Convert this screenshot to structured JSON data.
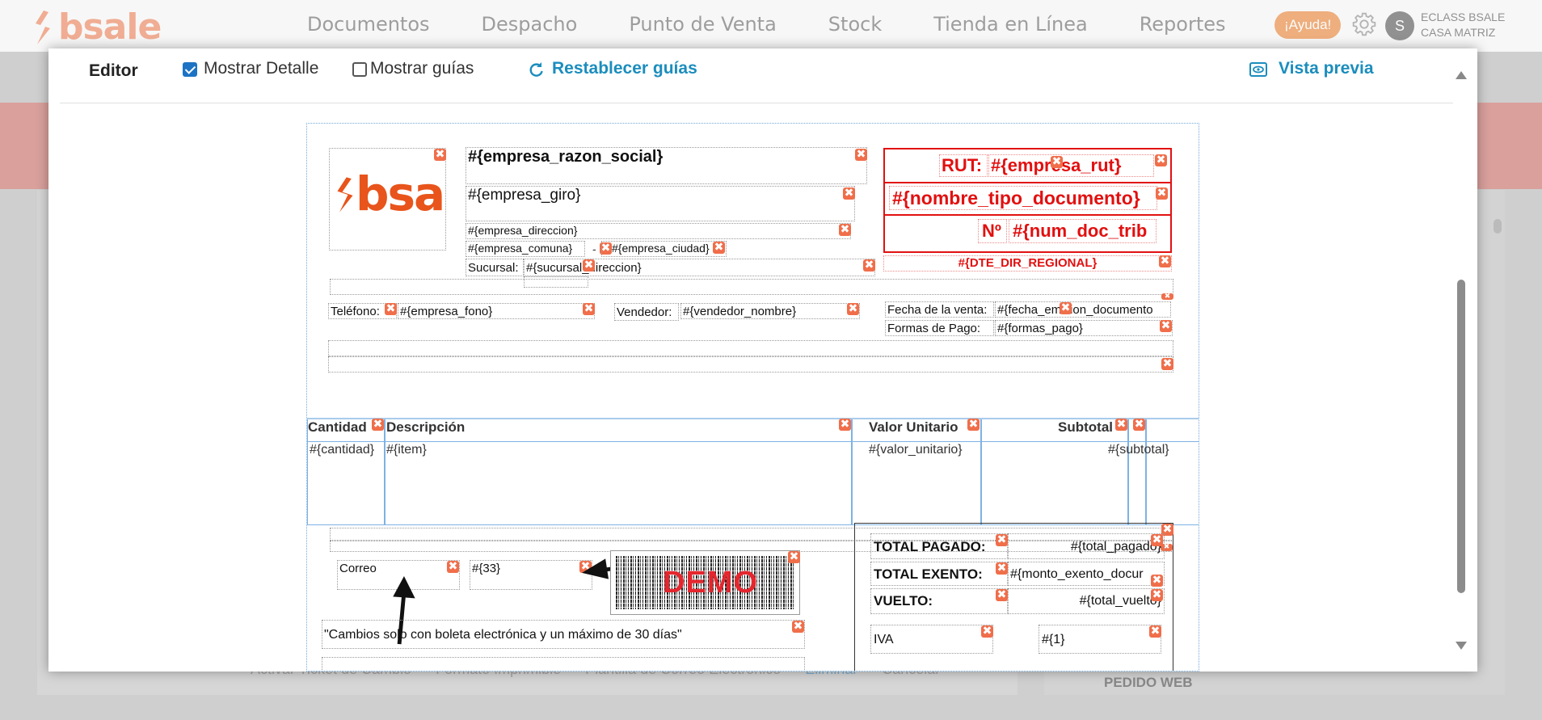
{
  "app": {
    "brand": "bsale",
    "nav": [
      "Documentos",
      "Despacho",
      "Punto de Venta",
      "Stock",
      "Tienda en Línea",
      "Reportes"
    ],
    "help": "¡Ayuda!",
    "avatar_letter": "S",
    "user_line1": "ECLASS BSALE",
    "user_line2": "CASA MATRIZ",
    "bg_footer": [
      "Activar Ticket de Cambio",
      "Formato Imprimible",
      "Plantilla de Correo Electrónico",
      "Eliminar",
      "Cancelar"
    ],
    "bg_pedido": "PEDIDO WEB"
  },
  "toolbar": {
    "editor": "Editor",
    "show_detail": "Mostrar Detalle",
    "show_detail_checked": true,
    "show_guides": "Mostrar guías",
    "show_guides_checked": false,
    "reset_guides": "Restablecer guías",
    "preview": "Vista previa"
  },
  "template": {
    "logo_text": "bsale",
    "empresa_razon_social": "#{empresa_razon_social}",
    "empresa_giro": "#{empresa_giro}",
    "empresa_direccion": "#{empresa_direccion}",
    "empresa_comuna": "#{empresa_comuna}",
    "dash": "-",
    "empresa_ciudad": "#{empresa_ciudad}",
    "sucursal_label": "Sucursal:",
    "sucursal_direccion": "#{sucursal_direccion}",
    "rut_label": "RUT:",
    "empresa_rut": "#{empresa_rut}",
    "nombre_tipo_documento": "#{nombre_tipo_documento}",
    "num_label": "Nº",
    "num_doc": "#{num_doc_trib",
    "dte_dir_regional": "#{DTE_DIR_REGIONAL}",
    "telefono_label": "Teléfono:",
    "empresa_fono": "#{empresa_fono}",
    "vendedor_label": "Vendedor:",
    "vendedor_nombre": "#{vendedor_nombre}",
    "fecha_venta_label": "Fecha de la venta:",
    "fecha_emision": "#{fecha_emision_documento",
    "formas_pago_label": "Formas de Pago:",
    "formas_pago": "#{formas_pago}",
    "table_headers": [
      "Cantidad",
      "Descripción",
      "Valor Unitario",
      "Subtotal"
    ],
    "table_cells": [
      "#{cantidad}",
      "#{item}",
      "#{valor_unitario}",
      "#{subtotal}"
    ],
    "correo_label": "Correo",
    "field_33": "#{33}",
    "demo": "DEMO",
    "total_pagado_label": "TOTAL PAGADO:",
    "total_pagado": "#{total_pagado}",
    "total_exento_label": "TOTAL EXENTO:",
    "monto_exento": "#{monto_exento_docur",
    "vuelto_label": "VUELTO:",
    "total_vuelto": "#{total_vuelto}",
    "iva_label": "IVA",
    "field_1": "#{1}",
    "note": "\"Cambios solo con boleta electrónica y un máximo de 30 días\"",
    "delete_glyph": "✖"
  },
  "colors": {
    "brand": "#e8541b",
    "link": "#1b8dbd",
    "doc_red": "#e21010",
    "guide_blue": "#7eb2e4"
  }
}
